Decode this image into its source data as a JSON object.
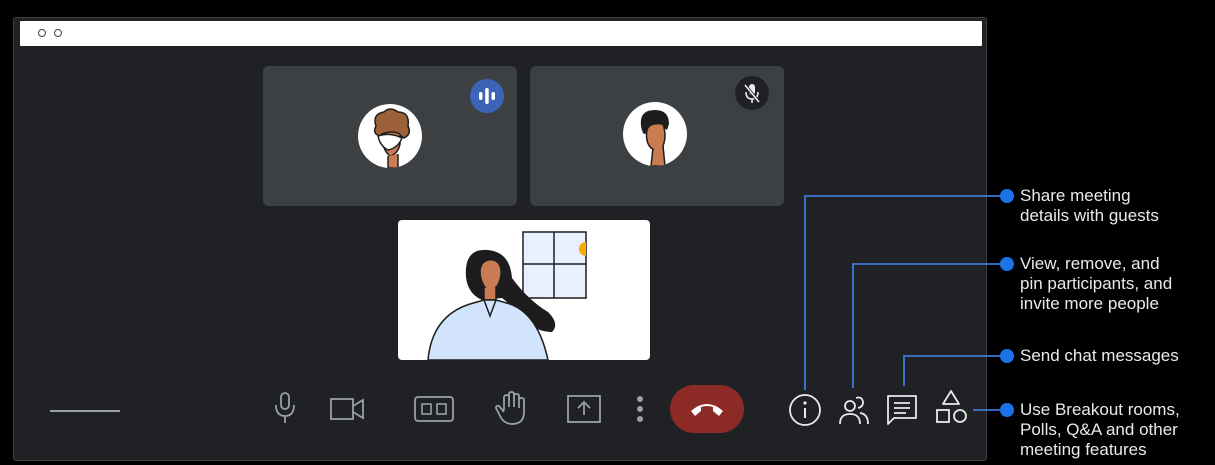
{
  "annotations": [
    {
      "line1": "Share meeting",
      "line2": "details with guests",
      "line3": ""
    },
    {
      "line1": "View, remove, and",
      "line2": "pin participants, and",
      "line3": "invite more people"
    },
    {
      "line1": "Send chat messages",
      "line2": "",
      "line3": ""
    },
    {
      "line1": "Use Breakout rooms,",
      "line2": "Polls, Q&A and other",
      "line3": "meeting features"
    }
  ],
  "icons": {
    "speaking_indicator": "speaking-indicator-icon",
    "muted": "mic-off-icon",
    "microphone": "microphone-icon",
    "camera": "camera-icon",
    "captions": "closed-captions-icon",
    "raise_hand": "raise-hand-icon",
    "present": "present-screen-icon",
    "more": "more-options-icon",
    "end_call": "end-call-icon",
    "info": "meeting-info-icon",
    "people": "people-icon",
    "chat": "chat-icon",
    "activities": "activities-icon"
  },
  "colors": {
    "accent": "#1a73e8",
    "speaking_badge": "#3b63b8",
    "end_call": "#8c2b26",
    "window_bg": "#202124",
    "tile_bg": "#3c4043"
  }
}
